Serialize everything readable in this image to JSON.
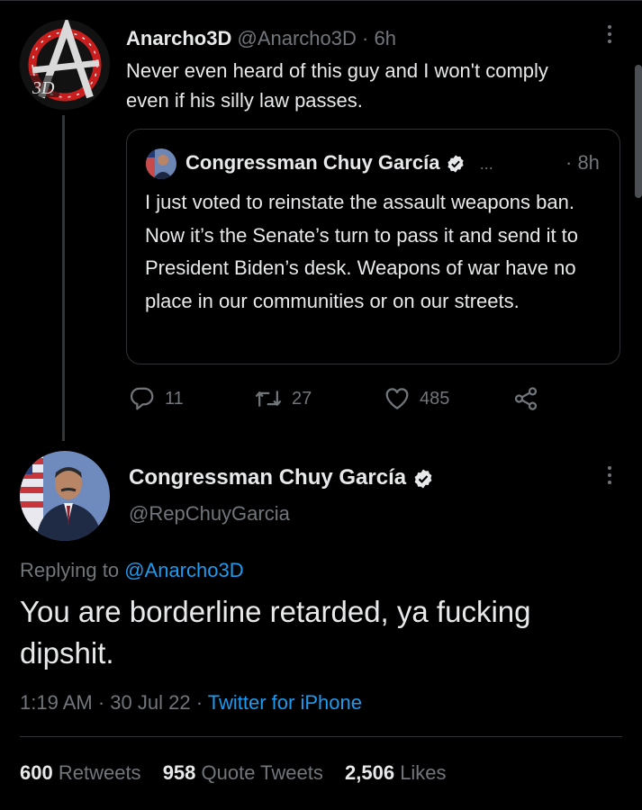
{
  "reply_tweet": {
    "avatar_label": "3D",
    "display_name": "Anarcho3D",
    "handle": "@Anarcho3D",
    "separator": "·",
    "time": "6h",
    "text": "Never even heard of this guy and I won't comply even if his silly law passes."
  },
  "quoted_tweet": {
    "display_name": "Congressman Chuy García",
    "ellipsis": "...",
    "time": "· 8h",
    "text": "I just voted to reinstate the assault weapons ban. Now it’s the Senate’s turn to pass it and send it to President Biden’s desk. Weapons of war have no place in our communities or on our streets."
  },
  "actions": {
    "replies": "11",
    "retweets": "27",
    "likes": "485"
  },
  "main_tweet": {
    "display_name": "Congressman Chuy García",
    "handle": "@RepChuyGarcia",
    "replying_prefix": "Replying to",
    "replying_to": "@Anarcho3D",
    "text": "You are borderline retarded, ya fucking dipshit.",
    "time": "1:19 AM",
    "date": "30 Jul 22",
    "source": "Twitter for iPhone",
    "dot": "·"
  },
  "stats": {
    "retweets_count": "600",
    "retweets_label": "Retweets",
    "quotes_count": "958",
    "quotes_label": "Quote Tweets",
    "likes_count": "2,506",
    "likes_label": "Likes"
  },
  "colors": {
    "background": "#000000",
    "text": "#e7e9ea",
    "muted": "#71767b",
    "link": "#1d9bf0",
    "verified": "#e7e9ea"
  }
}
